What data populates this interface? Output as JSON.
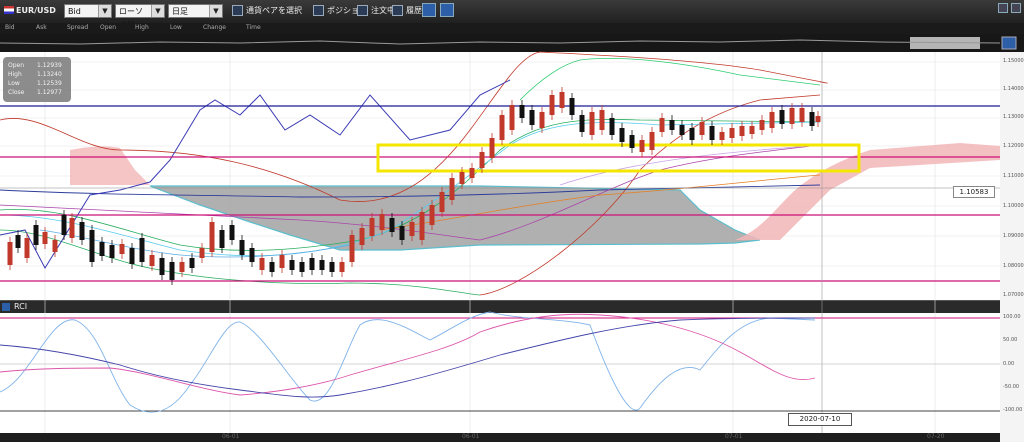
{
  "toolbar": {
    "symbol": "EUR/USD",
    "price_type": "Bid",
    "chart_type": "ローソク足",
    "period": "日足",
    "select_pair_label": "通貨ペアを選択",
    "position_label": "ポジション",
    "order_label": "注文中",
    "history_label": "履歴"
  },
  "legend": [
    "Bid",
    "Ask",
    "Spread",
    "Open",
    "High",
    "Low",
    "Change",
    "Time"
  ],
  "ohlc": {
    "open_label": "Open",
    "open": "1.12939",
    "high_label": "High",
    "high": "1.13240",
    "low_label": "Low",
    "low": "1.12539",
    "close_label": "Close",
    "close": "1.12977"
  },
  "price_tag": "1.10583",
  "date_tag": "2020-07-10",
  "rci_label": "RCI",
  "price_axis": [
    "1.15000",
    "1.14000",
    "1.13000",
    "1.12000",
    "1.11000",
    "1.10000",
    "1.09000",
    "1.08000",
    "1.07000"
  ],
  "rci_axis": [
    "100.00",
    "50.00",
    "0.00",
    "-50.00",
    "-100.00"
  ],
  "x_axis": [
    "06-01",
    "06-01",
    "07-01",
    "07-20"
  ],
  "colors": {
    "bull": "#c0392b",
    "bear": "#111111",
    "highlight": "#f5e600",
    "hline_blue": "#1a1a99",
    "hline_magenta": "#cc1177"
  }
}
